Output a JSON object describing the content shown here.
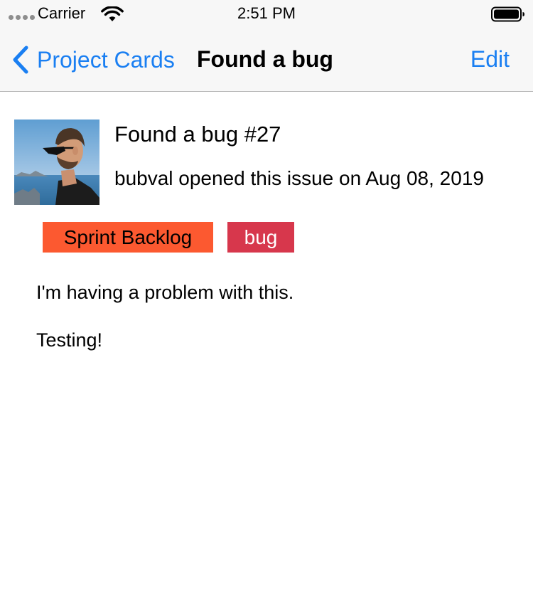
{
  "status_bar": {
    "carrier": "Carrier",
    "time": "2:51 PM",
    "icons": [
      "signal-dots-icon",
      "wifi-icon",
      "battery-icon"
    ]
  },
  "nav": {
    "back_label": "Project Cards",
    "title": "Found a bug",
    "edit_label": "Edit",
    "accent_color": "#1a7ff2"
  },
  "issue": {
    "title": "Found a bug #27",
    "meta": "bubval opened this issue on Aug 08, 2019",
    "labels": [
      {
        "name": "Sprint Backlog",
        "color": "#fc5930"
      },
      {
        "name": "bug",
        "color": "#d7374c"
      }
    ],
    "body": [
      "I'm having a problem with this.",
      "Testing!"
    ]
  }
}
